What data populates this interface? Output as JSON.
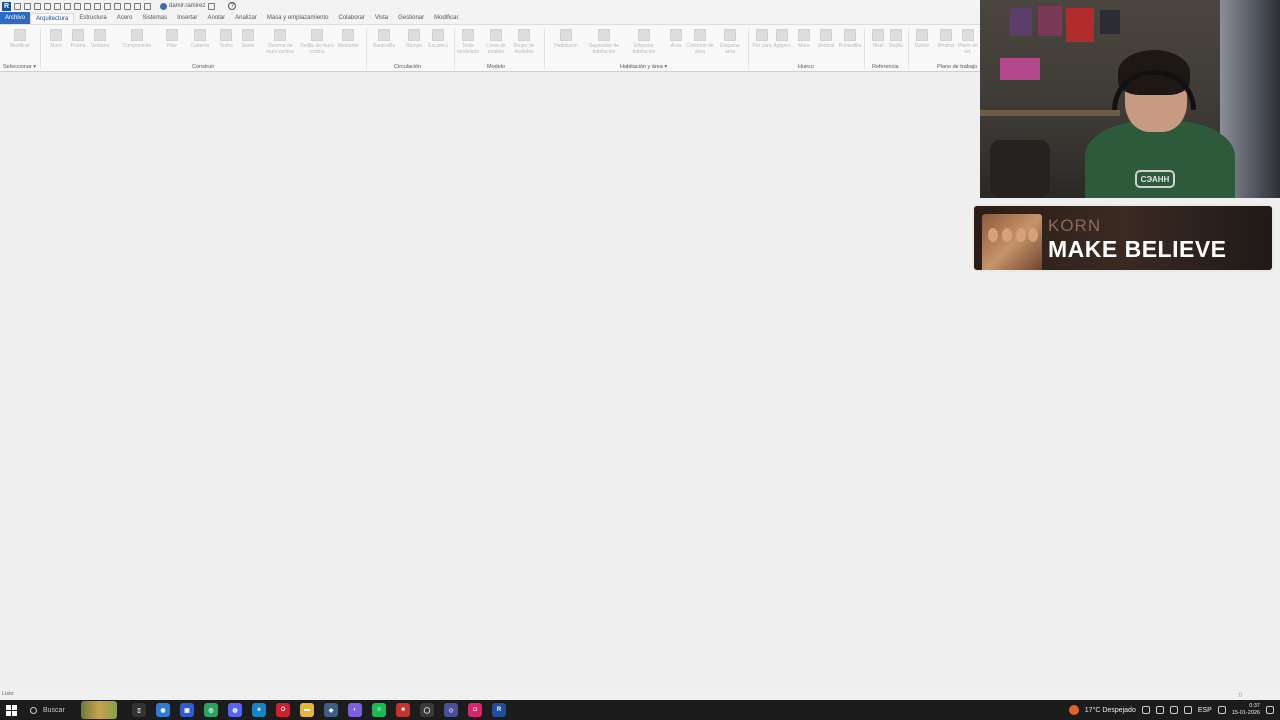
{
  "qat": {
    "app_logo": "R",
    "user_name": "damir.ramirez",
    "help": "?"
  },
  "tabs": [
    {
      "label": "Archivo"
    },
    {
      "label": "Arquitectura"
    },
    {
      "label": "Estructura"
    },
    {
      "label": "Acero"
    },
    {
      "label": "Sistemas"
    },
    {
      "label": "Insertar"
    },
    {
      "label": "Anotar"
    },
    {
      "label": "Analizar"
    },
    {
      "label": "Masa y emplazamiento"
    },
    {
      "label": "Colaborar"
    },
    {
      "label": "Vista"
    },
    {
      "label": "Gestionar"
    },
    {
      "label": "Modificar"
    }
  ],
  "ribbon": {
    "buttons": [
      "Modificar",
      "Muro",
      "Puerta",
      "Ventana",
      "Componente",
      "Pilar",
      "Cubierta",
      "Techo",
      "Suelo",
      "Sistema de muro cortina",
      "Rejilla de muro cortina",
      "Montante",
      "Barandilla",
      "Rampa",
      "Escalera",
      "Texto modelado",
      "Línea de modelo",
      "Grupo de modelos",
      "Habitación",
      "Separador de habitación",
      "Etiquetar habitación",
      "Área",
      "Contorno de área",
      "Etiquetar área",
      "Por cara",
      "Agujero",
      "Muro",
      "Vertical",
      "Buhardilla",
      "Nivel",
      "Rejilla",
      "Definir",
      "Mostrar",
      "Plano de ref."
    ],
    "panels": {
      "select": "Seleccionar ▾",
      "build": "Construir",
      "circulation": "Circulación",
      "model": "Modelo",
      "room": "Habitación y área ▾",
      "opening": "Hueco",
      "datum": "Referencia",
      "workplane": "Plano de trabajo"
    }
  },
  "status": {
    "left": "Listo",
    "filter": ":0"
  },
  "taskbar": {
    "search_label": "Buscar",
    "apps": [
      {
        "name": "task-view",
        "color": "#333333",
        "glyph": "▯"
      },
      {
        "name": "copilot",
        "color": "#2d7bd6",
        "glyph": "◉"
      },
      {
        "name": "store",
        "color": "#2f5bd8",
        "glyph": "▣"
      },
      {
        "name": "whatsapp",
        "color": "#25a55f",
        "glyph": "◎"
      },
      {
        "name": "discord",
        "color": "#5865f2",
        "glyph": "◍"
      },
      {
        "name": "edge",
        "color": "#1585c6",
        "glyph": "e"
      },
      {
        "name": "opera",
        "color": "#d21f2b",
        "glyph": "O"
      },
      {
        "name": "explorer",
        "color": "#e9b43b",
        "glyph": "▬"
      },
      {
        "name": "vscode",
        "color": "#3e5d8a",
        "glyph": "◆"
      },
      {
        "name": "messenger",
        "color": "#7b5fe0",
        "glyph": "◐"
      },
      {
        "name": "spotify",
        "color": "#1db954",
        "glyph": "≡"
      },
      {
        "name": "recorder",
        "color": "#c7322b",
        "glyph": "■"
      },
      {
        "name": "obs",
        "color": "#3a3a3a",
        "glyph": "◯"
      },
      {
        "name": "sketchup",
        "color": "#4b4f9a",
        "glyph": "◇"
      },
      {
        "name": "instagram",
        "color": "#d6246e",
        "glyph": "◘"
      },
      {
        "name": "revit",
        "color": "#1f4e9c",
        "glyph": "R"
      }
    ]
  },
  "tray": {
    "weather": "17°C  Despejado",
    "lang": "ESP",
    "time": "0:37",
    "date": "15-01-2026"
  },
  "now_playing": {
    "artist": "KORN",
    "title": "MAKE BELIEVE"
  },
  "webcam": {
    "shirt_text": "СЭАНН"
  }
}
